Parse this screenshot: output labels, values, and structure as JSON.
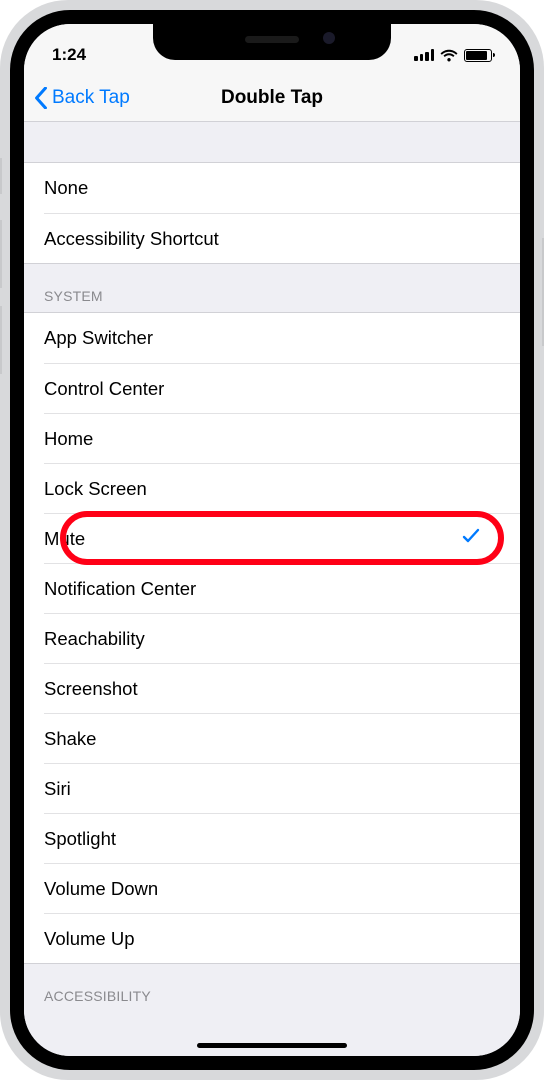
{
  "status": {
    "time": "1:24"
  },
  "nav": {
    "back_label": "Back Tap",
    "title": "Double Tap"
  },
  "sections": {
    "header_system": "SYSTEM",
    "header_accessibility": "ACCESSIBILITY"
  },
  "top_items": {
    "none": "None",
    "accessibility_shortcut": "Accessibility Shortcut"
  },
  "system_items": {
    "app_switcher": "App Switcher",
    "control_center": "Control Center",
    "home": "Home",
    "lock_screen": "Lock Screen",
    "mute": "Mute",
    "notification_center": "Notification Center",
    "reachability": "Reachability",
    "screenshot": "Screenshot",
    "shake": "Shake",
    "siri": "Siri",
    "spotlight": "Spotlight",
    "volume_down": "Volume Down",
    "volume_up": "Volume Up"
  },
  "selected_item": "mute"
}
